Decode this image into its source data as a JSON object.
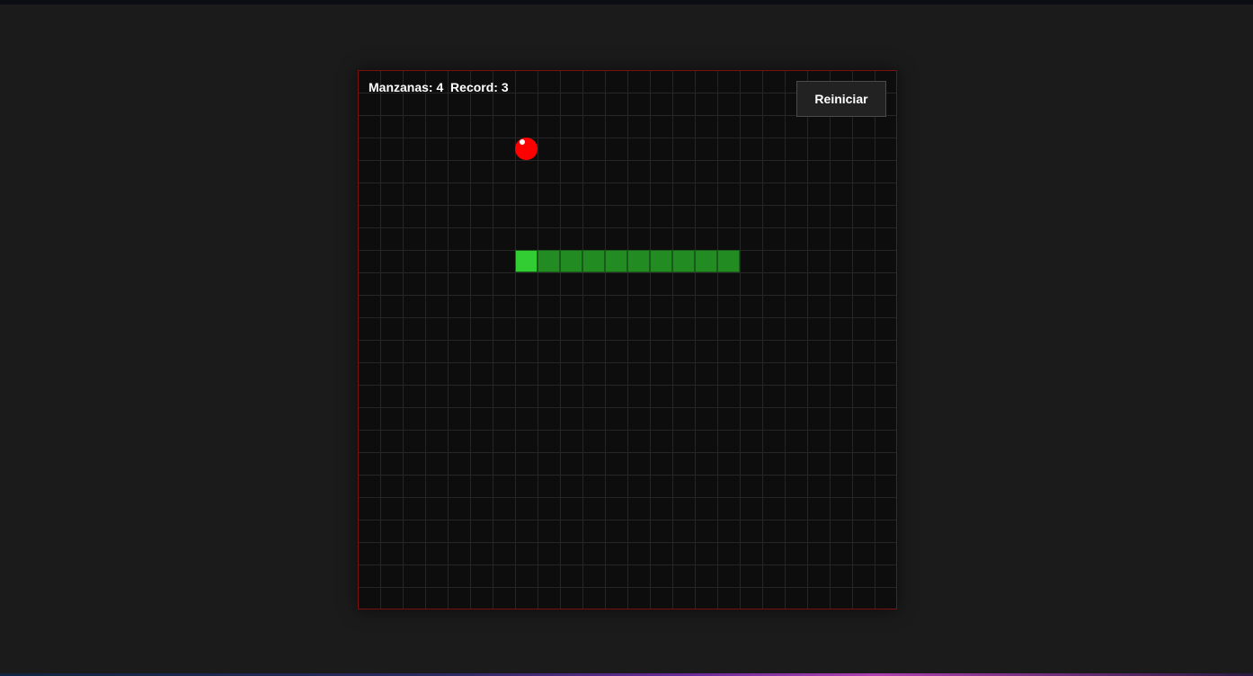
{
  "hud": {
    "apples_label": "Manzanas:",
    "apples_value": "4",
    "record_label": "Record:",
    "record_value": "3"
  },
  "controls": {
    "restart_label": "Reiniciar"
  },
  "game": {
    "grid": {
      "cols": 24,
      "rows": 24
    },
    "apple": {
      "col": 7,
      "row": 3
    },
    "snake": [
      {
        "col": 7,
        "row": 8
      },
      {
        "col": 8,
        "row": 8
      },
      {
        "col": 9,
        "row": 8
      },
      {
        "col": 10,
        "row": 8
      },
      {
        "col": 11,
        "row": 8
      },
      {
        "col": 12,
        "row": 8
      },
      {
        "col": 13,
        "row": 8
      },
      {
        "col": 14,
        "row": 8
      },
      {
        "col": 15,
        "row": 8
      },
      {
        "col": 16,
        "row": 8
      }
    ],
    "colors": {
      "snake_head": "#32cd32",
      "snake_body": "#228b22",
      "apple": "#ff0000",
      "board_border": "#7a1010"
    }
  }
}
